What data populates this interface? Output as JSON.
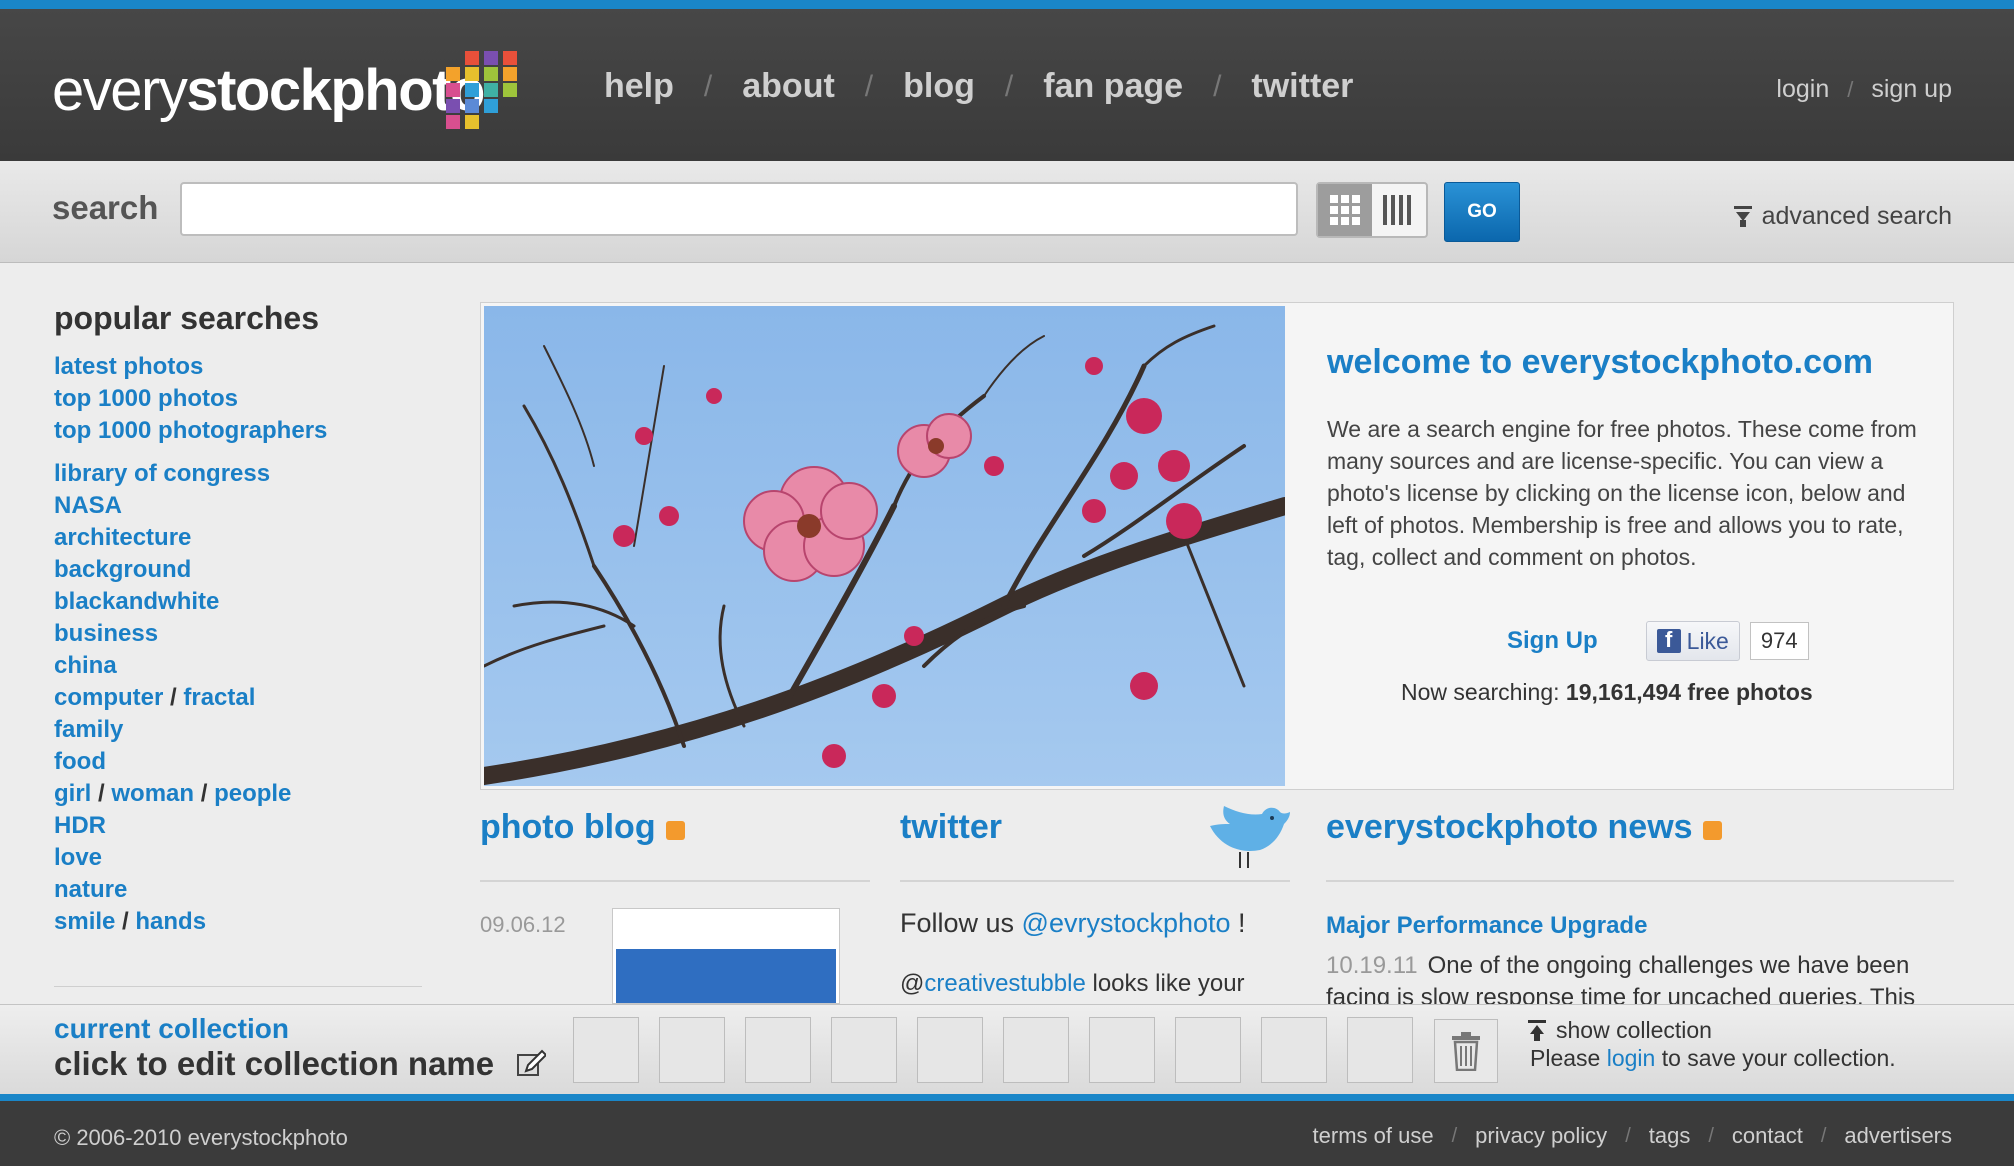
{
  "header": {
    "logo_light": "every",
    "logo_bold": "stockphoto",
    "nav": [
      "help",
      "about",
      "blog",
      "fan page",
      "twitter"
    ],
    "account": [
      "login",
      "sign up"
    ],
    "separator": "/"
  },
  "search": {
    "label": "search",
    "placeholder": "",
    "value": "",
    "go_label": "GO",
    "advanced_label": "advanced search"
  },
  "sidebar": {
    "title": "popular searches",
    "group1": [
      [
        "latest photos"
      ],
      [
        "top 1000 photos"
      ],
      [
        "top 1000 photographers"
      ]
    ],
    "group2": [
      [
        "library of congress"
      ],
      [
        "NASA"
      ],
      [
        "architecture"
      ],
      [
        "background"
      ],
      [
        "blackandwhite"
      ],
      [
        "business"
      ],
      [
        "china"
      ],
      [
        "computer",
        "fractal"
      ],
      [
        "family"
      ],
      [
        "food"
      ],
      [
        "girl",
        "woman",
        "people"
      ],
      [
        "HDR"
      ],
      [
        "love"
      ],
      [
        "nature"
      ],
      [
        "smile",
        "hands"
      ]
    ]
  },
  "welcome": {
    "title": "welcome to everystockphoto.com",
    "text": "We are a search engine for free photos. These come from many sources and are license-specific. You can view a photo's license by clicking on the license icon, below and left of photos. Membership is free and allows you to rate, tag, collect and comment on photos.",
    "signup_label": "Sign Up",
    "like_label": "Like",
    "like_count": "974",
    "searching_prefix": "Now searching: ",
    "searching_count": "19,161,494 free photos"
  },
  "blog": {
    "title": "photo blog",
    "date": "09.06.12"
  },
  "twitter": {
    "title": "twitter",
    "follow_prefix": "Follow us ",
    "follow_handle": "@evrystockphoto",
    "follow_suffix": " !",
    "tweet_prefix": "@",
    "tweet_handle": "creativestubble",
    "tweet_text": " looks like your"
  },
  "news": {
    "title": "everystockphoto news",
    "item_title": "Major Performance Upgrade",
    "item_date": "10.19.11",
    "item_text": "One of the ongoing challenges we have been facing is slow response time for uncached queries. This"
  },
  "collection": {
    "label": "current collection",
    "name": "click to edit collection name",
    "slots": 10,
    "show_label": "show collection",
    "save_prefix": "Please ",
    "save_link": "login",
    "save_suffix": " to save your collection."
  },
  "footer": {
    "copyright": "© 2006-2010 everystockphoto",
    "links": [
      "terms of use",
      "privacy policy",
      "tags",
      "contact",
      "advertisers"
    ]
  },
  "colors": {
    "accent_blue": "#1a86c8",
    "link_blue": "#1a7fc6",
    "header_bg": "#474747",
    "logo_squares": [
      "#e8503a",
      "#f3a22b",
      "#9ec43b",
      "#2f9fd8",
      "#7a4fb0",
      "#e6c02d",
      "#d84f8f",
      "#3fb0a4",
      "#5b8ad6"
    ]
  }
}
